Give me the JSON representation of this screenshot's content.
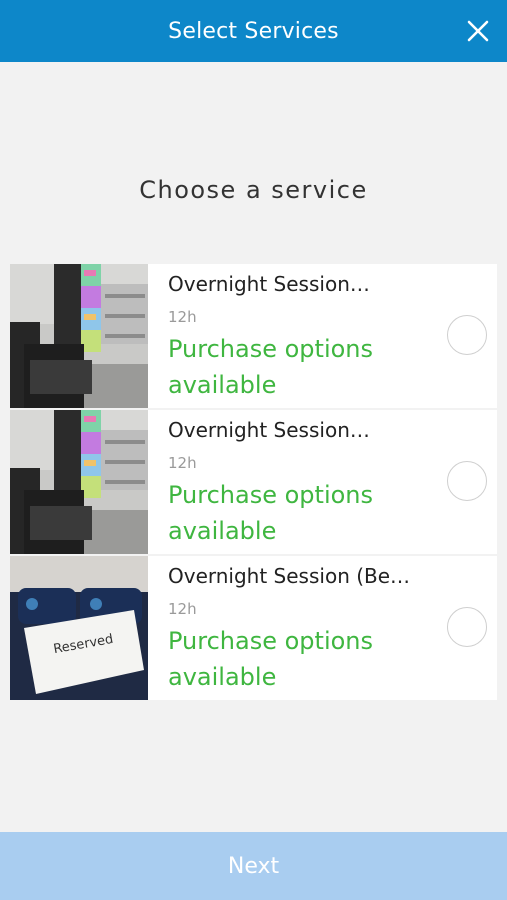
{
  "header": {
    "title": "Select Services",
    "close_icon": "close-icon",
    "background": "#0d87c9"
  },
  "heading": "Choose a service",
  "services": [
    {
      "title": "Overnight Session…",
      "duration": "12h",
      "purchase": "Purchase options available",
      "image": "room-with-chair-and-screens"
    },
    {
      "title": "Overnight Session…",
      "duration": "12h",
      "purchase": "Purchase options available",
      "image": "room-with-chair-and-screens"
    },
    {
      "title": "Overnight Session (Be…",
      "duration": "12h",
      "purchase": "Purchase options available",
      "image": "bed-with-reserved-sign",
      "image_text": "Reserved"
    }
  ],
  "footer": {
    "next_label": "Next",
    "background": "#a9cdf0"
  },
  "colors": {
    "accent_green": "#3fb640",
    "page_background": "#f2f2f2"
  }
}
